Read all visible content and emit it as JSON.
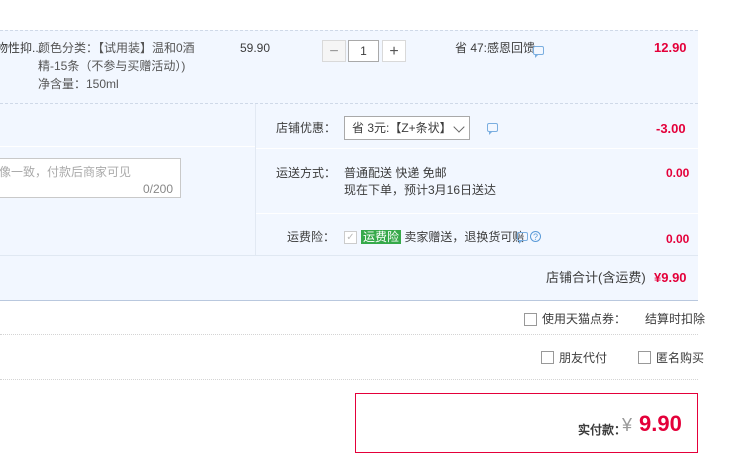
{
  "item": {
    "title_partial": "物性抑...",
    "sku_lines": [
      "颜色分类：【试用装】温和0酒",
      "精-15条（不参与买赠活动）)",
      "净含量：150ml"
    ],
    "unit_price": "59.90",
    "quantity": "1",
    "qty_minus": "−",
    "qty_plus": "+",
    "promo": "省 47:感恩回馈",
    "subtotal": "12.90"
  },
  "shop": {
    "discount_label": "店铺优惠：",
    "discount_select": "省 3元:【Z+条状】",
    "discount_amount": "-3.00",
    "shipping_label": "运送方式：",
    "shipping_method": "普通配送 快递 免邮",
    "shipping_eta": "现在下单，预计3月16日送达",
    "shipping_amount": "0.00",
    "insurance_label": "运费险：",
    "insurance_tag": "运费险",
    "insurance_desc": "卖家赠送，退换货可赔",
    "insurance_amount": "0.00",
    "message_placeholder": "像一致，付款后商家可见",
    "message_counter": "0/200",
    "total_label": "店铺合计(含运费)",
    "total_amount": "¥9.90"
  },
  "options": {
    "tmall_points_label": "使用天猫点券：",
    "tmall_points_note": "结算时扣除",
    "friend_pay_label": "朋友代付",
    "anonymous_label": "匿名购买"
  },
  "payment": {
    "label": "实付款：",
    "currency": "¥",
    "amount": "9.90"
  },
  "colors": {
    "accent_red": "#e4003a",
    "panel_bg": "#f2f7ff",
    "insurance_green": "#36a94a"
  }
}
